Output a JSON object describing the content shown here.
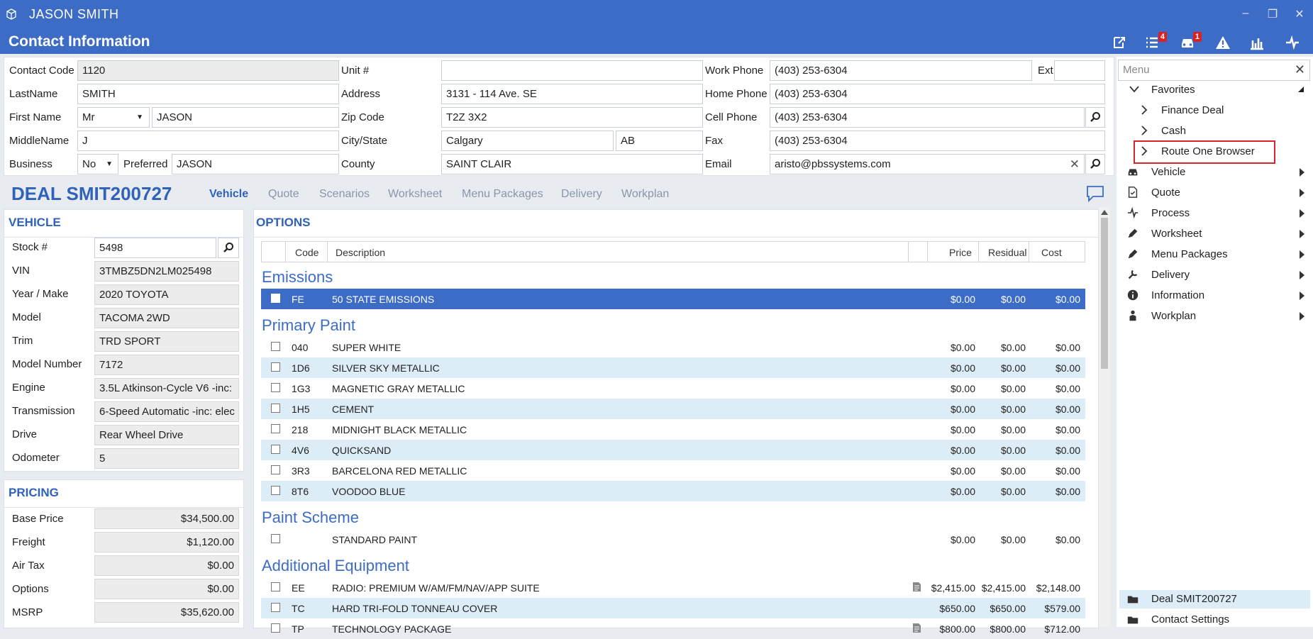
{
  "window": {
    "user": "JASON SMITH",
    "header_title": "Contact Information",
    "badges": {
      "tasks": "4",
      "vehicles": "1"
    }
  },
  "contact": {
    "labels": {
      "contact_code": "Contact Code",
      "last_name": "LastName",
      "first_name": "First Name",
      "middle_name": "MiddleName",
      "business": "Business",
      "preferred": "Preferred",
      "unit": "Unit #",
      "address": "Address",
      "zip": "Zip Code",
      "city_state": "City/State",
      "county": "County",
      "work_phone": "Work Phone",
      "ext": "Ext.",
      "home_phone": "Home Phone",
      "cell_phone": "Cell Phone",
      "fax": "Fax",
      "email": "Email"
    },
    "values": {
      "contact_code": "1120",
      "last_name": "SMITH",
      "salutation": "Mr",
      "first_name": "JASON",
      "middle_name": "J",
      "business": "No",
      "preferred": "JASON",
      "unit": "",
      "address": "3131 - 114 Ave. SE",
      "zip": "T2Z 3X2",
      "city": "Calgary",
      "state": "AB",
      "county": "SAINT CLAIR",
      "work_phone": "(403) 253-6304",
      "ext": "",
      "home_phone": "(403) 253-6304",
      "cell_phone": "(403) 253-6304",
      "fax": "(403) 253-6304",
      "email": "aristo@pbssystems.com"
    }
  },
  "deal": {
    "title": "DEAL SMIT200727",
    "tabs": [
      "Vehicle",
      "Quote",
      "Scenarios",
      "Worksheet",
      "Menu Packages",
      "Delivery",
      "Workplan"
    ],
    "active_tab": "Vehicle"
  },
  "vehicle": {
    "title": "VEHICLE",
    "fields": [
      {
        "label": "Stock #",
        "value": "5498"
      },
      {
        "label": "VIN",
        "value": "3TMBZ5DN2LM025498"
      },
      {
        "label": "Year / Make",
        "value": "2020 TOYOTA"
      },
      {
        "label": "Model",
        "value": "TACOMA 2WD"
      },
      {
        "label": "Trim",
        "value": "TRD SPORT"
      },
      {
        "label": "Model Number",
        "value": "7172"
      },
      {
        "label": "Engine",
        "value": "3.5L Atkinson-Cycle V6 -inc:"
      },
      {
        "label": "Transmission",
        "value": "6-Speed Automatic -inc: elec"
      },
      {
        "label": "Drive",
        "value": "Rear Wheel Drive"
      },
      {
        "label": "Odometer",
        "value": "5"
      }
    ]
  },
  "pricing": {
    "title": "PRICING",
    "fields": [
      {
        "label": "Base Price",
        "value": "$34,500.00"
      },
      {
        "label": "Freight",
        "value": "$1,120.00"
      },
      {
        "label": "Air Tax",
        "value": "$0.00"
      },
      {
        "label": "Options",
        "value": "$0.00"
      },
      {
        "label": "MSRP",
        "value": "$35,620.00"
      }
    ]
  },
  "options": {
    "title": "OPTIONS",
    "columns": {
      "code": "Code",
      "description": "Description",
      "price": "Price",
      "residual": "Residual",
      "cost": "Cost"
    },
    "groups": [
      {
        "name": "Emissions",
        "rows": [
          {
            "code": "FE",
            "desc": "50 STATE EMISSIONS",
            "price": "$0.00",
            "residual": "$0.00",
            "cost": "$0.00",
            "selected": true
          }
        ]
      },
      {
        "name": "Primary Paint",
        "rows": [
          {
            "code": "040",
            "desc": "SUPER WHITE",
            "price": "$0.00",
            "residual": "$0.00",
            "cost": "$0.00"
          },
          {
            "code": "1D6",
            "desc": "SILVER SKY METALLIC",
            "price": "$0.00",
            "residual": "$0.00",
            "cost": "$0.00"
          },
          {
            "code": "1G3",
            "desc": "MAGNETIC GRAY METALLIC",
            "price": "$0.00",
            "residual": "$0.00",
            "cost": "$0.00"
          },
          {
            "code": "1H5",
            "desc": "CEMENT",
            "price": "$0.00",
            "residual": "$0.00",
            "cost": "$0.00"
          },
          {
            "code": "218",
            "desc": "MIDNIGHT BLACK METALLIC",
            "price": "$0.00",
            "residual": "$0.00",
            "cost": "$0.00"
          },
          {
            "code": "4V6",
            "desc": "QUICKSAND",
            "price": "$0.00",
            "residual": "$0.00",
            "cost": "$0.00"
          },
          {
            "code": "3R3",
            "desc": "BARCELONA RED METALLIC",
            "price": "$0.00",
            "residual": "$0.00",
            "cost": "$0.00"
          },
          {
            "code": "8T6",
            "desc": "VOODOO BLUE",
            "price": "$0.00",
            "residual": "$0.00",
            "cost": "$0.00"
          }
        ]
      },
      {
        "name": "Paint Scheme",
        "rows": [
          {
            "code": "",
            "desc": "STANDARD PAINT",
            "price": "$0.00",
            "residual": "$0.00",
            "cost": "$0.00"
          }
        ]
      },
      {
        "name": "Additional Equipment",
        "rows": [
          {
            "code": "EE",
            "desc": "RADIO: PREMIUM W/AM/FM/NAV/APP SUITE",
            "price": "$2,415.00",
            "residual": "$2,415.00",
            "cost": "$2,148.00",
            "note": true
          },
          {
            "code": "TC",
            "desc": "HARD TRI-FOLD TONNEAU COVER",
            "price": "$650.00",
            "residual": "$650.00",
            "cost": "$579.00"
          },
          {
            "code": "TP",
            "desc": "TECHNOLOGY PACKAGE",
            "price": "$800.00",
            "residual": "$800.00",
            "cost": "$712.00",
            "note": true
          }
        ]
      }
    ]
  },
  "menu": {
    "search_placeholder": "Menu",
    "favorites_label": "Favorites",
    "favorites": [
      "Finance Deal",
      "Cash",
      "Route One Browser"
    ],
    "highlighted_favorite": "Route One Browser",
    "items": [
      {
        "label": "Vehicle",
        "icon": "car-icon"
      },
      {
        "label": "Quote",
        "icon": "document-icon"
      },
      {
        "label": "Process",
        "icon": "process-icon"
      },
      {
        "label": "Worksheet",
        "icon": "pencil-icon"
      },
      {
        "label": "Menu Packages",
        "icon": "pencil-icon"
      },
      {
        "label": "Delivery",
        "icon": "wrench-icon"
      },
      {
        "label": "Information",
        "icon": "info-icon"
      },
      {
        "label": "Workplan",
        "icon": "worker-icon"
      }
    ],
    "bottom": [
      {
        "label": "Deal SMIT200727",
        "active": true
      },
      {
        "label": "Contact Settings"
      }
    ]
  },
  "colors": {
    "accent": "#3c6cc6",
    "title_blue": "#2f62b8",
    "row_alt": "#dcedf7",
    "highlight_box": "#d9232d",
    "badge": "#e02020"
  }
}
